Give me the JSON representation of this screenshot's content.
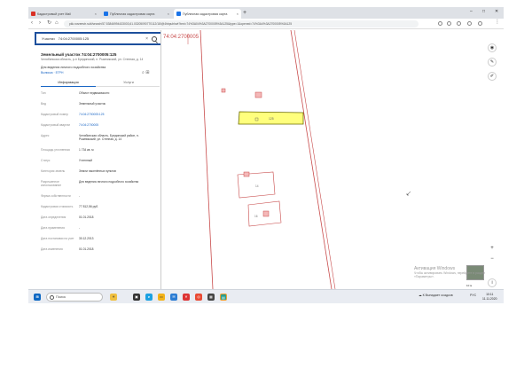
{
  "browser": {
    "tabs": [
      {
        "label": "Кадастровый учет Mail",
        "color": "#d93025"
      },
      {
        "label": "Публичная кадастровая карта",
        "color": "#1a73e8"
      },
      {
        "label": "Публичная кадастровая карта",
        "color": "#1a73e8"
      }
    ],
    "new_tab": "+",
    "win_min": "–",
    "win_max": "□",
    "win_close": "✕",
    "nav_back": "‹",
    "nav_forward": "›",
    "nav_reload": "↻",
    "nav_home": "⌂",
    "url": "pkk.rosreestr.ru/#/search/57.53846994433003,61.03205090770112/18/@4hbpuhhwt?text=74%3A04%3A2700005%3A125&type=1&opened=74%3A4%3A2700005%3A125"
  },
  "panel": {
    "search_type": "Участки",
    "search_value": "74:04:2700005:125",
    "title": "Земельный участок 74:04:2700005:125",
    "subtitle": "Челябинская область, р-н Брединский, п. Рымникский, ул. Степная, д. 14",
    "purpose": "Для ведения личного подсобного хозяйства",
    "links": "Выписка · ЕГРН",
    "tabs": {
      "active": "Информация",
      "other": "Услуги"
    },
    "rows": [
      {
        "k": "Тип",
        "v": "Объект недвижимости"
      },
      {
        "k": "Вид",
        "v": "Земельный участок"
      },
      {
        "k": "Кадастровый номер",
        "v": "74:04:2700005:125",
        "link": true
      },
      {
        "k": "Кадастровый квартал",
        "v": "74:04:2700005",
        "link": true
      },
      {
        "k": "Адрес",
        "v": "Челябинская область, Брединский район, п. Рымникский, ул. Степная, д. 14"
      },
      {
        "k": "Площадь уточненная",
        "v": "1 734 кв. м"
      },
      {
        "k": "Статус",
        "v": "Учтенный"
      },
      {
        "k": "Категория земель",
        "v": "Земли населённых пунктов"
      },
      {
        "k": "Разрешенное использование",
        "v": "Для ведения личного подсобного хозяйства"
      },
      {
        "k": "Форма собственности",
        "v": "-"
      },
      {
        "k": "Кадастровая стоимость",
        "v": "77 812,56 руб."
      },
      {
        "k": "Дата определения",
        "v": "01.01.2018"
      },
      {
        "k": "Дата применения",
        "v": "-"
      },
      {
        "k": "Дата постановки на учет",
        "v": "30.12.2013"
      },
      {
        "k": "Дата изменения",
        "v": "01.01.2018"
      }
    ]
  },
  "map": {
    "quarter_label": "74:04:2700005",
    "parcel_label": "125",
    "building_labels": [
      "14",
      "16"
    ],
    "buttons": {
      "layers": "◉",
      "edit": "✎",
      "measure": "✐",
      "zoom_in": "+",
      "zoom_out": "−",
      "info": "i"
    },
    "activation_title": "Активация Windows",
    "activation_sub": "Чтобы активировать Windows, перейдите в раздел «Параметры».",
    "scale": "10 м"
  },
  "taskbar": {
    "search_placeholder": "Поиск",
    "tray": "☁  К Выпадает осадков",
    "lang": "РУС",
    "time": "10:11",
    "date": "11.11.2020"
  }
}
